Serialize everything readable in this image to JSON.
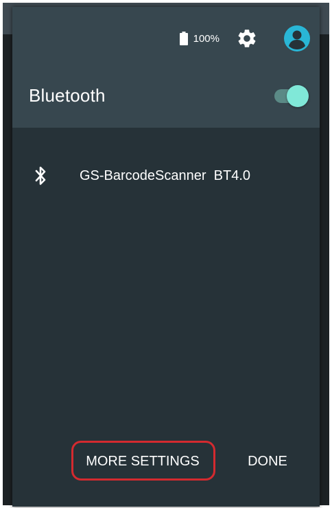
{
  "status_bar": {
    "battery_percent": "100%",
    "icons": [
      "battery-icon",
      "gear-icon",
      "account-avatar-icon"
    ]
  },
  "bluetooth": {
    "title": "Bluetooth",
    "enabled": true
  },
  "devices": [
    {
      "icon": "bluetooth-icon",
      "name": "GS-BarcodeScanner  BT4.0"
    }
  ],
  "actions": {
    "more_settings_label": "MORE SETTINGS",
    "done_label": "DONE"
  },
  "colors": {
    "panel_bg": "#263238",
    "header_bg": "#37474f",
    "accent": "#80e8d8",
    "avatar": "#29b6d6",
    "highlight_ring": "#d42a2f"
  }
}
